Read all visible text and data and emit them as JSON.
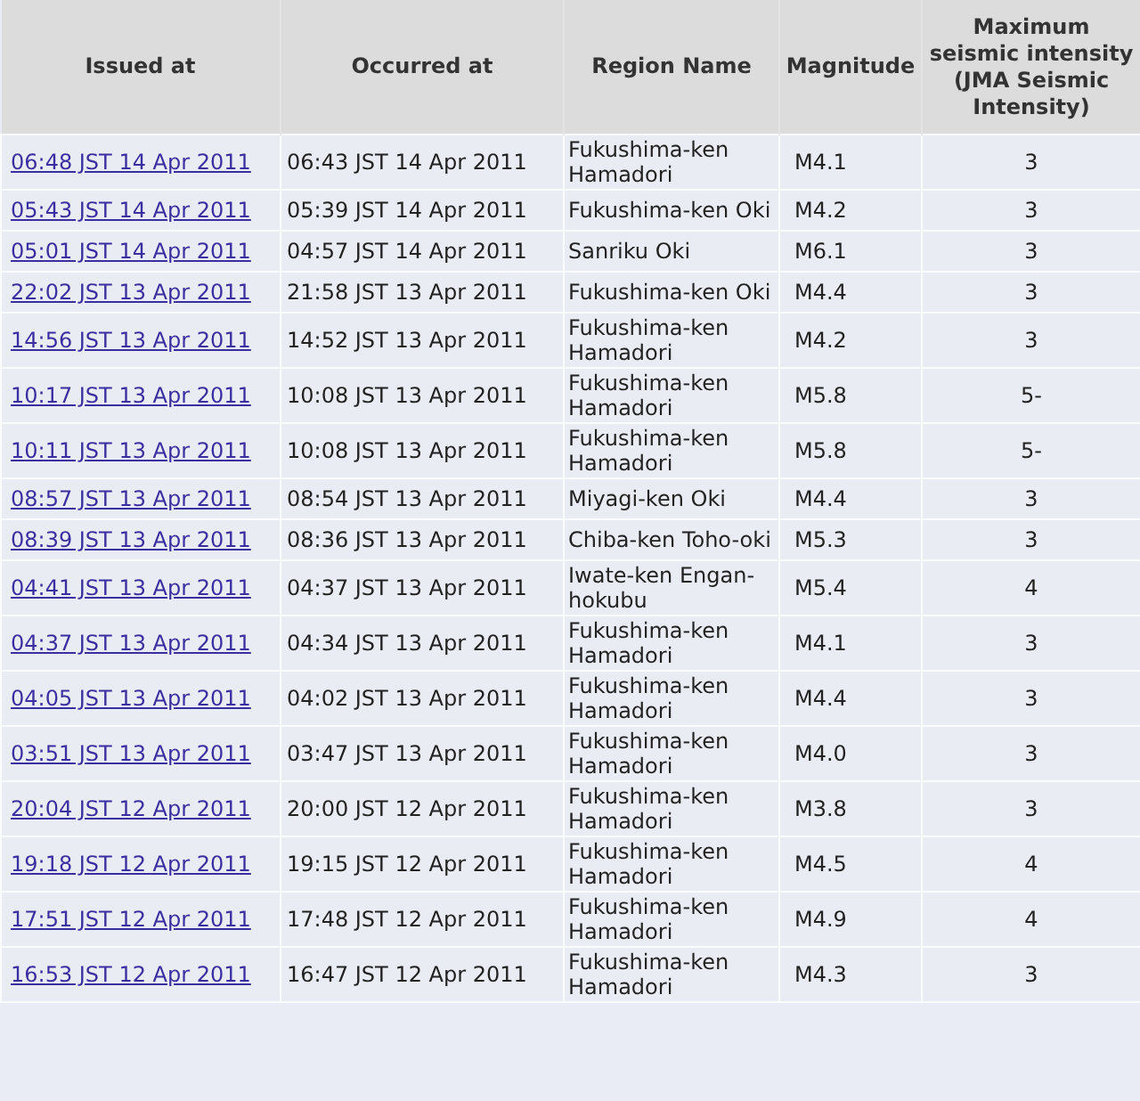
{
  "table": {
    "columns": [
      "Issued at",
      "Occurred at",
      "Region Name",
      "Magnitude",
      "Maximum seismic intensity (JMA Seismic Intensity)"
    ],
    "rows": [
      {
        "issued": "06:48 JST 14 Apr 2011",
        "occurred": "06:43 JST 14 Apr 2011",
        "region": "Fukushima-ken Hamadori",
        "magnitude": "M4.1",
        "intensity": "3"
      },
      {
        "issued": "05:43 JST 14 Apr 2011",
        "occurred": "05:39 JST 14 Apr 2011",
        "region": "Fukushima-ken Oki",
        "magnitude": "M4.2",
        "intensity": "3"
      },
      {
        "issued": "05:01 JST 14 Apr 2011",
        "occurred": "04:57 JST 14 Apr 2011",
        "region": "Sanriku Oki",
        "magnitude": "M6.1",
        "intensity": "3"
      },
      {
        "issued": "22:02 JST 13 Apr 2011",
        "occurred": "21:58 JST 13 Apr 2011",
        "region": "Fukushima-ken Oki",
        "magnitude": "M4.4",
        "intensity": "3"
      },
      {
        "issued": "14:56 JST 13 Apr 2011",
        "occurred": "14:52 JST 13 Apr 2011",
        "region": "Fukushima-ken Hamadori",
        "magnitude": "M4.2",
        "intensity": "3"
      },
      {
        "issued": "10:17 JST 13 Apr 2011",
        "occurred": "10:08 JST 13 Apr 2011",
        "region": "Fukushima-ken Hamadori",
        "magnitude": "M5.8",
        "intensity": "5-"
      },
      {
        "issued": "10:11 JST 13 Apr 2011",
        "occurred": "10:08 JST 13 Apr 2011",
        "region": "Fukushima-ken Hamadori",
        "magnitude": "M5.8",
        "intensity": "5-"
      },
      {
        "issued": "08:57 JST 13 Apr 2011",
        "occurred": "08:54 JST 13 Apr 2011",
        "region": "Miyagi-ken Oki",
        "magnitude": "M4.4",
        "intensity": "3"
      },
      {
        "issued": "08:39 JST 13 Apr 2011",
        "occurred": "08:36 JST 13 Apr 2011",
        "region": "Chiba-ken Toho-oki",
        "magnitude": "M5.3",
        "intensity": "3"
      },
      {
        "issued": "04:41 JST 13 Apr 2011",
        "occurred": "04:37 JST 13 Apr 2011",
        "region": "Iwate-ken Engan-hokubu",
        "magnitude": "M5.4",
        "intensity": "4"
      },
      {
        "issued": "04:37 JST 13 Apr 2011",
        "occurred": "04:34 JST 13 Apr 2011",
        "region": "Fukushima-ken Hamadori",
        "magnitude": "M4.1",
        "intensity": "3"
      },
      {
        "issued": "04:05 JST 13 Apr 2011",
        "occurred": "04:02 JST 13 Apr 2011",
        "region": "Fukushima-ken Hamadori",
        "magnitude": "M4.4",
        "intensity": "3"
      },
      {
        "issued": "03:51 JST 13 Apr 2011",
        "occurred": "03:47 JST 13 Apr 2011",
        "region": "Fukushima-ken Hamadori",
        "magnitude": "M4.0",
        "intensity": "3"
      },
      {
        "issued": "20:04 JST 12 Apr 2011",
        "occurred": "20:00 JST 12 Apr 2011",
        "region": "Fukushima-ken Hamadori",
        "magnitude": "M3.8",
        "intensity": "3"
      },
      {
        "issued": "19:18 JST 12 Apr 2011",
        "occurred": "19:15 JST 12 Apr 2011",
        "region": "Fukushima-ken Hamadori",
        "magnitude": "M4.5",
        "intensity": "4"
      },
      {
        "issued": "17:51 JST 12 Apr 2011",
        "occurred": "17:48 JST 12 Apr 2011",
        "region": "Fukushima-ken Hamadori",
        "magnitude": "M4.9",
        "intensity": "4"
      },
      {
        "issued": "16:53 JST 12 Apr 2011",
        "occurred": "16:47 JST 12 Apr 2011",
        "region": "Fukushima-ken Hamadori",
        "magnitude": "M4.3",
        "intensity": "3"
      }
    ]
  }
}
